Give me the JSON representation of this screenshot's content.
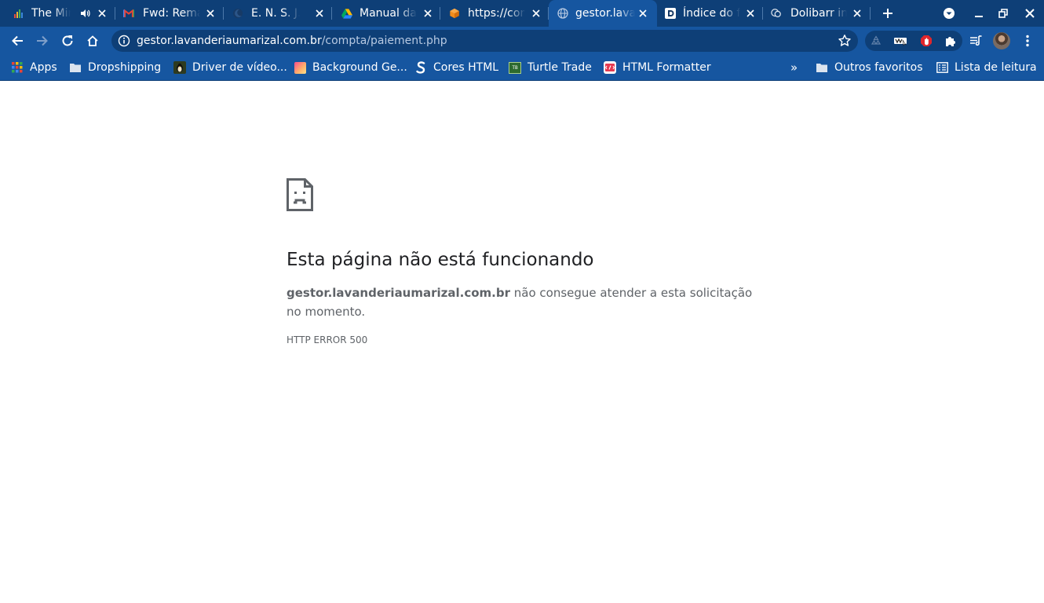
{
  "tabs": [
    {
      "title": "The Mind",
      "favicon": "equalizer-icon",
      "audio": true,
      "active": false
    },
    {
      "title": "Fwd: Remarketing",
      "favicon": "gmail-icon",
      "active": false
    },
    {
      "title": "E. N. S. J. C.",
      "favicon": "moon-icon",
      "active": false
    },
    {
      "title": "Manual da marca",
      "favicon": "google-drive-icon",
      "active": false
    },
    {
      "title": "https://conta",
      "favicon": "box-icon",
      "active": false
    },
    {
      "title": "gestor.lavanderia",
      "favicon": "globe-icon",
      "active": true
    },
    {
      "title": "Índice do fórum",
      "favicon": "dolibarr-d-icon",
      "active": false
    },
    {
      "title": "Dolibarr inst",
      "favicon": "forum-icon",
      "active": false
    }
  ],
  "toolbar": {
    "url_host": "gestor.lavanderiaumarizal.com.br",
    "url_path": "/compta/paiement.php"
  },
  "bookmarks": {
    "items": [
      {
        "label": "Apps",
        "icon": "apps-grid-icon"
      },
      {
        "label": "Dropshipping",
        "icon": "folder-icon"
      },
      {
        "label": "Driver de vídeo...",
        "icon": "penguin-icon"
      },
      {
        "label": "Background Ge...",
        "icon": "gradient-icon"
      },
      {
        "label": "Cores HTML",
        "icon": "s-logo-icon"
      },
      {
        "label": "Turtle Trade",
        "icon": "tradingview-icon"
      },
      {
        "label": "HTML Formatter",
        "icon": "html-formatter-icon"
      }
    ],
    "overflow": "»",
    "other_favorites": "Outros favoritos",
    "reading_list": "Lista de leitura"
  },
  "error": {
    "title": "Esta página não está funcionando",
    "host": "gestor.lavanderiaumarizal.com.br",
    "message_rest": " não consegue atender a esta solicitação no momento.",
    "code": "HTTP ERROR 500"
  },
  "colors": {
    "tab_strip": "#0e3f77",
    "toolbar": "#1656a0",
    "text_primary": "#202124",
    "text_secondary": "#5f6368"
  }
}
